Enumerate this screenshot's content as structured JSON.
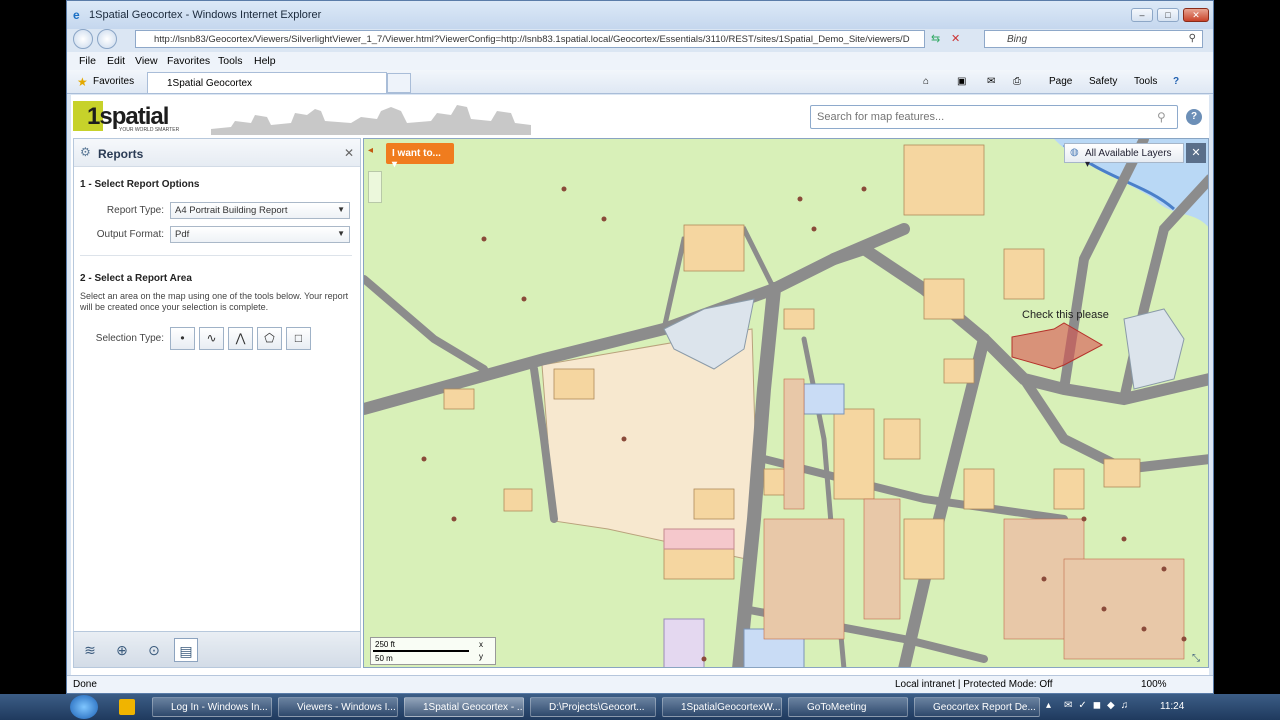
{
  "window": {
    "title": "1Spatial Geocortex - Windows Internet Explorer",
    "address": "http://lsnb83/Geocortex/Viewers/SilverlightViewer_1_7/Viewer.html?ViewerConfig=http://lsnb83.1spatial.local/Geocortex/Essentials/3110/REST/sites/1Spatial_Demo_Site/viewers/D",
    "search_provider": "Bing"
  },
  "menu": [
    "File",
    "Edit",
    "View",
    "Favorites",
    "Tools",
    "Help"
  ],
  "favorites": {
    "label": "Favorites",
    "tab_title": "1Spatial Geocortex",
    "commands": [
      "Page",
      "Safety",
      "Tools"
    ]
  },
  "app": {
    "logo_text": "1spatial",
    "logo_tagline": "YOUR WORLD SMARTER",
    "search_placeholder": "Search for map features...",
    "help_label": "?"
  },
  "panel": {
    "title": "Reports",
    "section1": "1 - Select Report Options",
    "report_type_label": "Report Type:",
    "report_type_value": "A4 Portrait Building Report",
    "output_format_label": "Output Format:",
    "output_format_value": "Pdf",
    "section2": "2 - Select a Report Area",
    "section2_desc": "Select an area on the map using one of the tools below. Your report will be created once your selection is complete.",
    "selection_type_label": "Selection Type:"
  },
  "map": {
    "i_want_to": "I want to...",
    "layers_label": "All Available Layers",
    "annotation": "Check this please",
    "scale_top": "250 ft",
    "scale_bottom": "50 m"
  },
  "status": {
    "left": "Done",
    "zone": "Local intranet | Protected Mode: Off",
    "zoom": "100%"
  },
  "taskbar": {
    "items": [
      "Log In - Windows In...",
      "Viewers - Windows I...",
      "1Spatial Geocortex - ...",
      "D:\\Projects\\Geocort...",
      "1SpatialGeocortexW...",
      "GoToMeeting",
      "Geocortex Report De..."
    ],
    "clock": "11:24"
  },
  "colors": {
    "map_land": "#d8f0b8",
    "road": "#8c8c8c",
    "building": "#f5d6a0",
    "accent_orange": "#f07c1e",
    "selection_red": "#d9534f"
  }
}
